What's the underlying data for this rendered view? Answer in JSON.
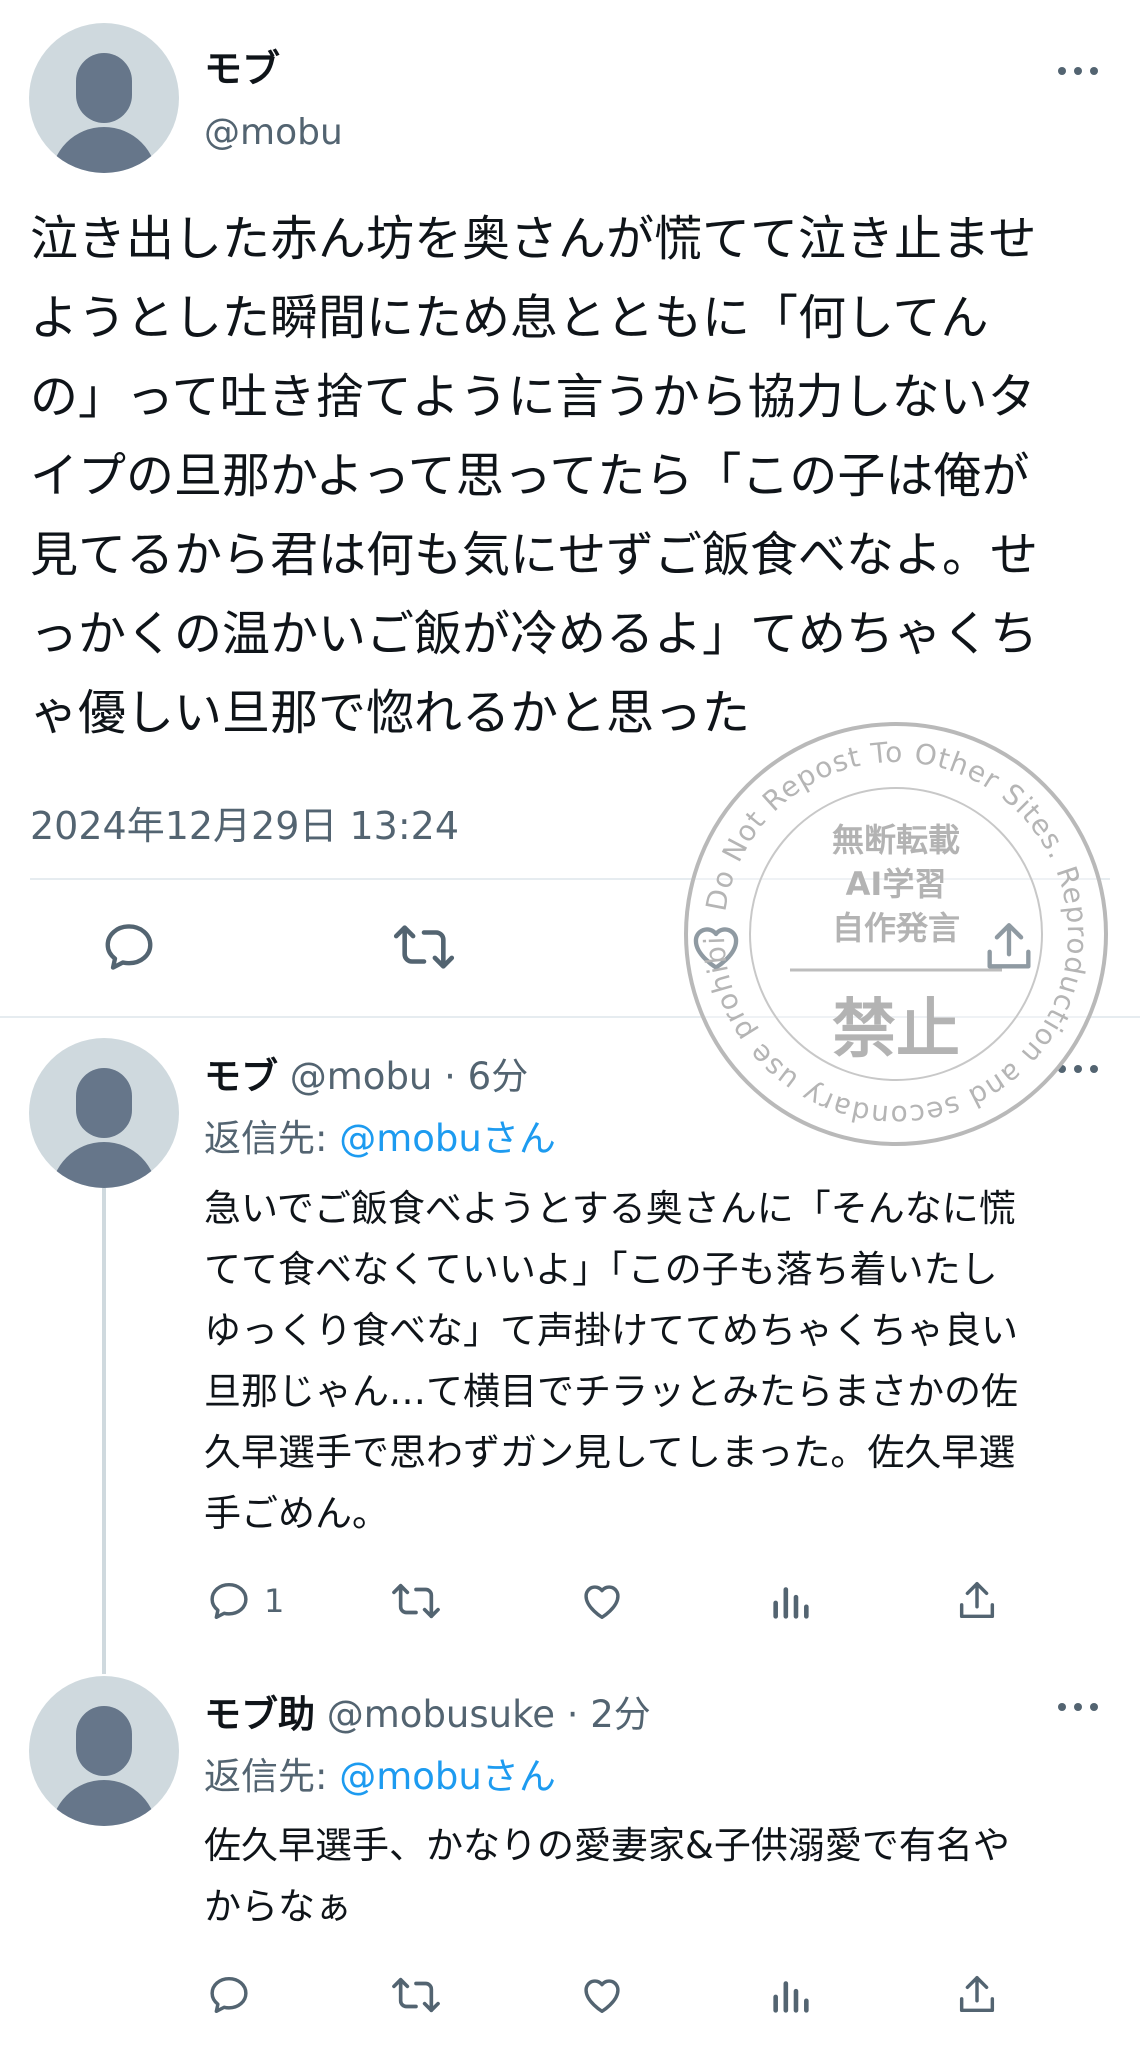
{
  "main_tweet": {
    "name": "モブ",
    "handle": "@mobu",
    "lines": [
      "泣き出した赤ん坊を奥さんが慌てて泣き止ませ",
      "ようとした瞬間にため息とともに「何してん",
      "の」って吐き捨てように言うから協力しないタ",
      "イプの旦那かよって思ってたら「この子は俺が",
      "見てるから君は何も気にせずご飯食べなよ。せ",
      "っかくの温かいご飯が冷めるよ」てめちゃくち",
      "ゃ優しい旦那で惚れるかと思った"
    ],
    "timestamp": "2024年12月29日 13:24",
    "actions": [
      "reply-icon",
      "retweet-icon",
      "like-icon",
      "share-icon"
    ]
  },
  "replies": [
    {
      "name": "モブ",
      "handle_time": "@mobu · 6分",
      "reply_to_label": "返信先: ",
      "reply_to_handle": "@mobuさん",
      "lines": [
        "急いでご飯食べようとする奥さんに「そんなに慌",
        "てて食べなくていいよ」「この子も落ち着いたし",
        "ゆっくり食べな」て声掛けててめちゃくちゃ良い",
        "旦那じゃん…て横目でチラッとみたらまさかの佐",
        "久早選手で思わずガン見してしまった。佐久早選",
        "手ごめん。"
      ],
      "reply_count": "1"
    },
    {
      "name": "モブ助",
      "handle_time": "@mobusuke · 2分",
      "reply_to_label": "返信先: ",
      "reply_to_handle": "@mobuさん",
      "lines": [
        "佐久早選手、かなりの愛妻家&子供溺愛で有名や",
        "からなぁ"
      ],
      "reply_count": ""
    }
  ],
  "watermark": {
    "ring_text": "Do Not Repost To Other Sites. Reproduction and secondary use prohibited.",
    "line1": "無断転載",
    "line2": "AI学習",
    "line3": "自作発言",
    "line4": "禁止"
  },
  "colors": {
    "text": "#0f1419",
    "muted": "#536471",
    "accent": "#1d9bf0",
    "avatar_bg": "#cfd9de",
    "avatar_fg": "#66768a"
  }
}
